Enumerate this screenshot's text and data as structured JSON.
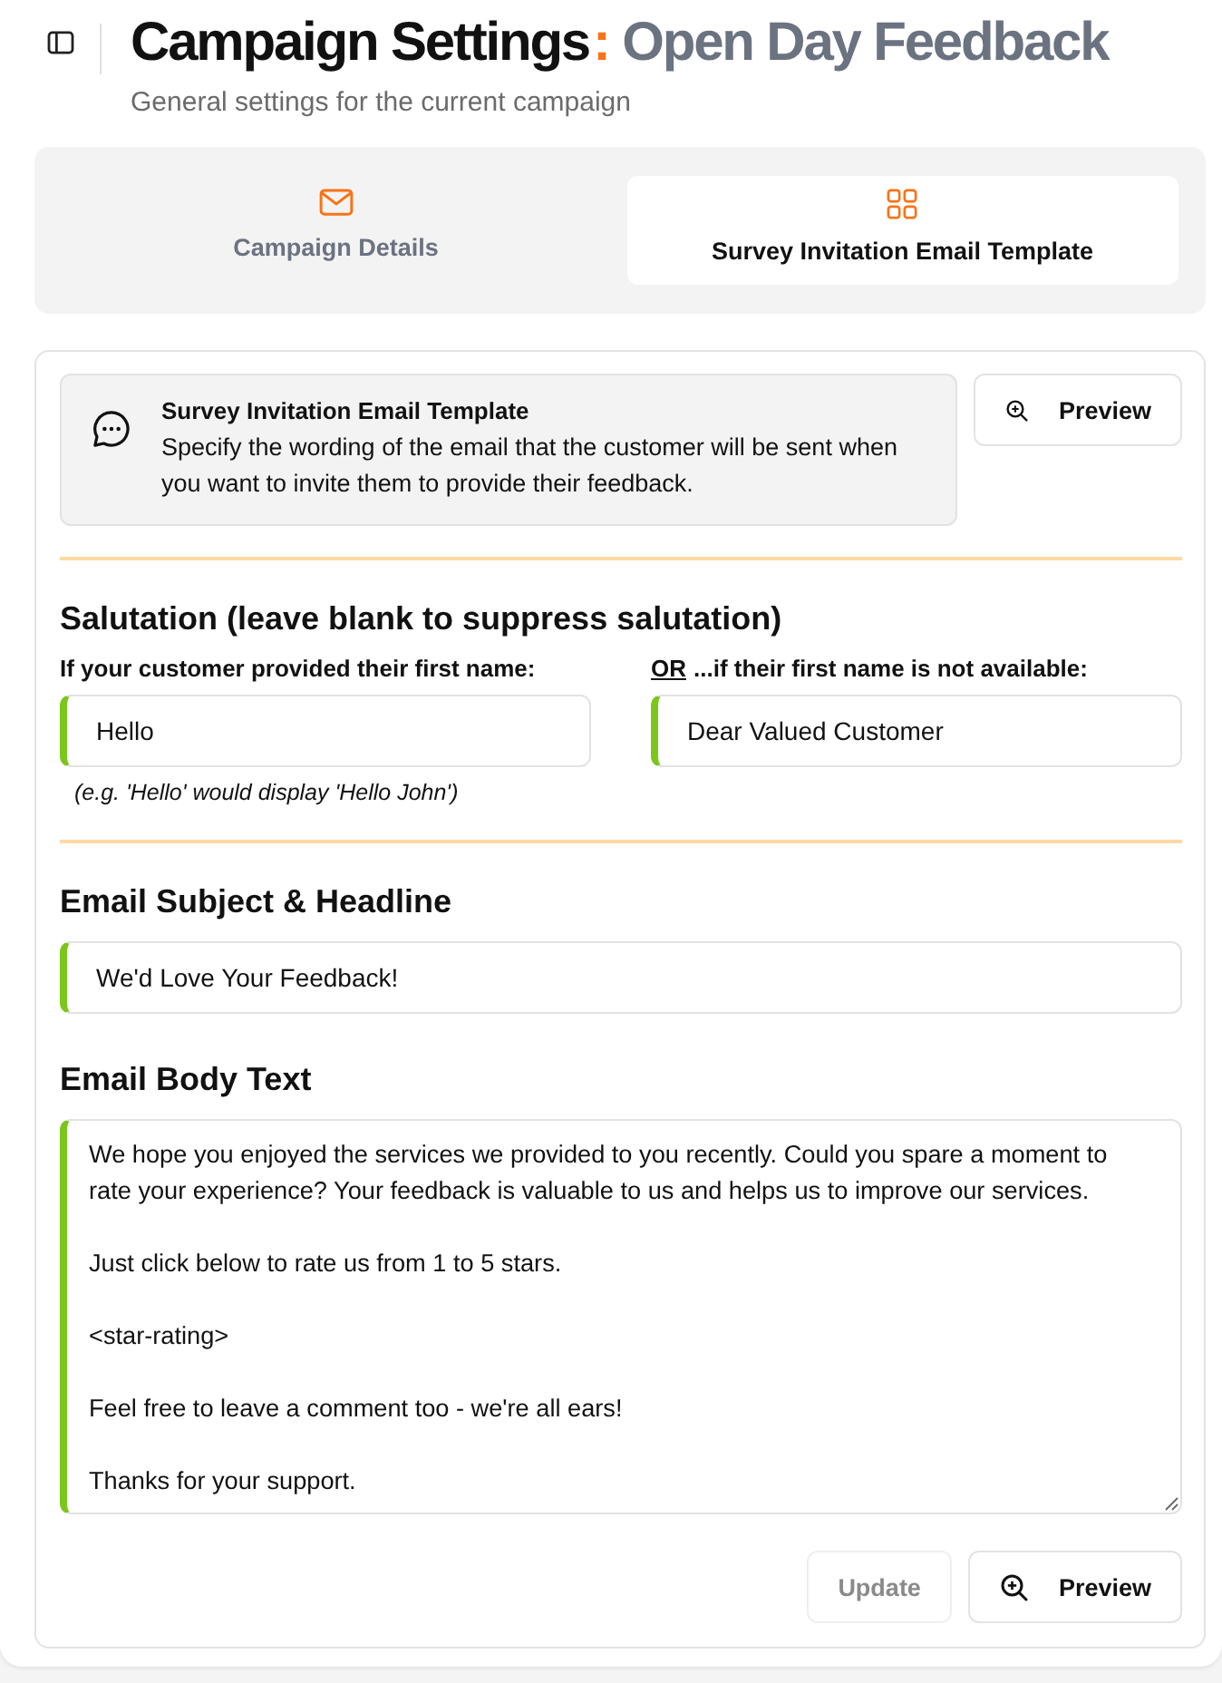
{
  "header": {
    "title": "Campaign Settings",
    "separator": ":",
    "campaign_name": "Open Day Feedback",
    "subtitle": "General settings for the current campaign"
  },
  "tabs": [
    {
      "label": "Campaign Details",
      "selected": false
    },
    {
      "label": "Survey Invitation Email Template",
      "selected": true
    }
  ],
  "info": {
    "title": "Survey Invitation Email Template",
    "description": "Specify the wording of the email that the customer will be sent when you want to invite them to provide their feedback.",
    "preview_button": "Preview"
  },
  "salutation": {
    "heading": "Salutation (leave blank to suppress salutation)",
    "fields": [
      {
        "label": "If your customer provided their first name:",
        "value": "Hello",
        "hint": "(e.g. 'Hello' would display 'Hello John')"
      },
      {
        "emphasis": "OR",
        "label": "...if their first name is not available:",
        "value": "Dear Valued Customer"
      }
    ]
  },
  "subject": {
    "heading": "Email Subject & Headline",
    "value": "We'd Love Your Feedback!"
  },
  "body": {
    "heading": "Email Body Text",
    "value": "We hope you enjoyed the services we provided to you recently. Could you spare a moment to rate your experience? Your feedback is valuable to us and helps us to improve our services.\n\nJust click below to rate us from 1 to 5 stars.\n\n<star-rating>\n\nFeel free to leave a comment too - we're all ears!\n\nThanks for your support."
  },
  "actions": [
    {
      "kind": "plain",
      "label": "Update",
      "disabled": true
    },
    {
      "kind": "preview",
      "label": "Preview",
      "disabled": false
    }
  ]
}
